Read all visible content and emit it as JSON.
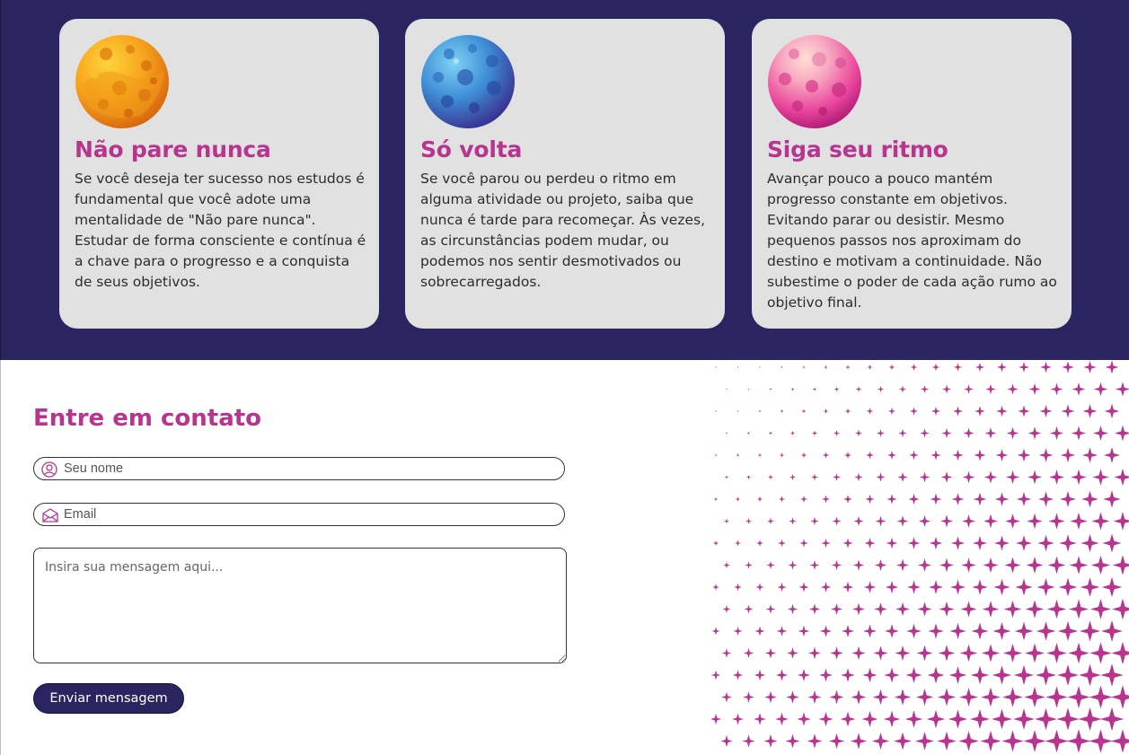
{
  "features": {
    "cards": [
      {
        "icon": "orange-planet-icon",
        "title": "Não pare nunca",
        "text": "Se você deseja ter sucesso nos estudos é fundamental que você adote uma mentalidade de \"Não pare nunca\". Estudar de forma consciente e contínua é a chave para o progresso e a conquista de seus objetivos."
      },
      {
        "icon": "blue-planet-icon",
        "title": "Só volta",
        "text": "Se você parou ou perdeu o ritmo em alguma atividade ou projeto, saiba que nunca é tarde para recomeçar. Às vezes, as circunstâncias podem mudar, ou podemos nos sentir desmotivados ou sobrecarregados."
      },
      {
        "icon": "pink-planet-icon",
        "title": "Siga seu ritmo",
        "text": "Avançar pouco a pouco mantém progresso constante em objetivos. Evitando parar ou desistir. Mesmo pequenos passos nos aproximam do destino e motivam a continuidade. Não subestime o poder de cada ação rumo ao objetivo final."
      }
    ]
  },
  "contact": {
    "title": "Entre em contato",
    "name_placeholder": "Seu nome",
    "email_placeholder": "Email",
    "message_placeholder": "Insira sua mensagem aqui...",
    "send_label": "Enviar mensagem"
  },
  "colors": {
    "primary_dark": "#2a2560",
    "accent_pink": "#b7358f",
    "card_bg": "#e1e1e1"
  }
}
